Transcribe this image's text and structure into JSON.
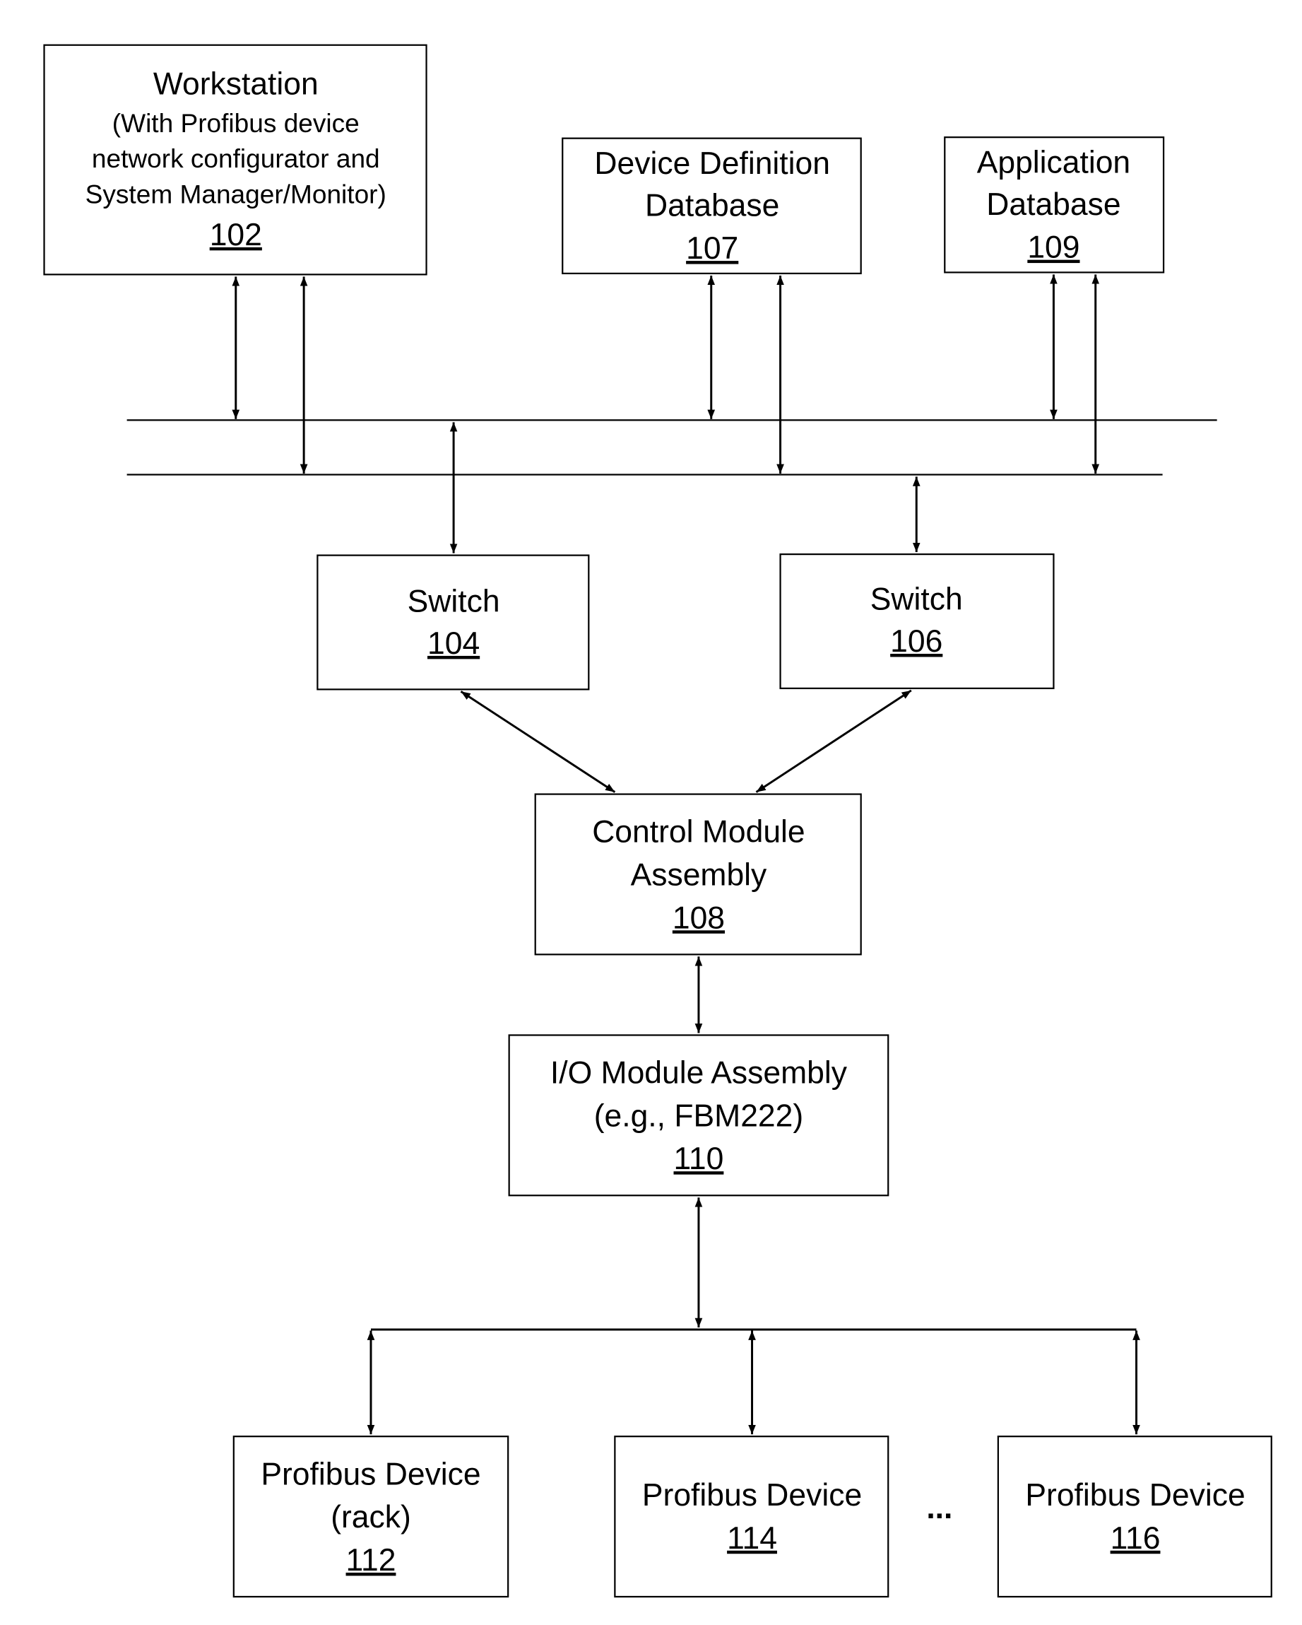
{
  "nodes": {
    "workstation": {
      "title": "Workstation",
      "lines": [
        "(With Profibus device",
        "network configurator and",
        "System Manager/Monitor)"
      ],
      "ref": "102"
    },
    "device_def_db": {
      "lines": [
        "Device Definition",
        "Database"
      ],
      "ref": "107"
    },
    "app_db": {
      "lines": [
        "Application",
        "Database"
      ],
      "ref": "109"
    },
    "switch_104": {
      "lines": [
        "Switch"
      ],
      "ref": "104"
    },
    "switch_106": {
      "lines": [
        "Switch"
      ],
      "ref": "106"
    },
    "control_module": {
      "lines": [
        "Control Module",
        "Assembly"
      ],
      "ref": "108"
    },
    "io_module": {
      "lines": [
        "I/O Module Assembly",
        "(e.g., FBM222)"
      ],
      "ref": "110"
    },
    "profibus_112": {
      "lines": [
        "Profibus Device",
        "(rack)"
      ],
      "ref": "112"
    },
    "profibus_114": {
      "lines": [
        "Profibus Device"
      ],
      "ref": "114"
    },
    "profibus_116": {
      "lines": [
        "Profibus Device"
      ],
      "ref": "116"
    }
  },
  "ellipsis": "...",
  "connections": [
    [
      "workstation",
      "network-bus-1"
    ],
    [
      "workstation",
      "network-bus-2"
    ],
    [
      "device_def_db",
      "network-bus-1"
    ],
    [
      "device_def_db",
      "network-bus-2"
    ],
    [
      "app_db",
      "network-bus-1"
    ],
    [
      "app_db",
      "network-bus-2"
    ],
    [
      "network-bus-1",
      "switch_104"
    ],
    [
      "network-bus-2",
      "switch_106"
    ],
    [
      "switch_104",
      "control_module"
    ],
    [
      "switch_106",
      "control_module"
    ],
    [
      "control_module",
      "io_module"
    ],
    [
      "io_module",
      "fieldbus"
    ],
    [
      "fieldbus",
      "profibus_112"
    ],
    [
      "fieldbus",
      "profibus_114"
    ],
    [
      "fieldbus",
      "profibus_116"
    ]
  ]
}
